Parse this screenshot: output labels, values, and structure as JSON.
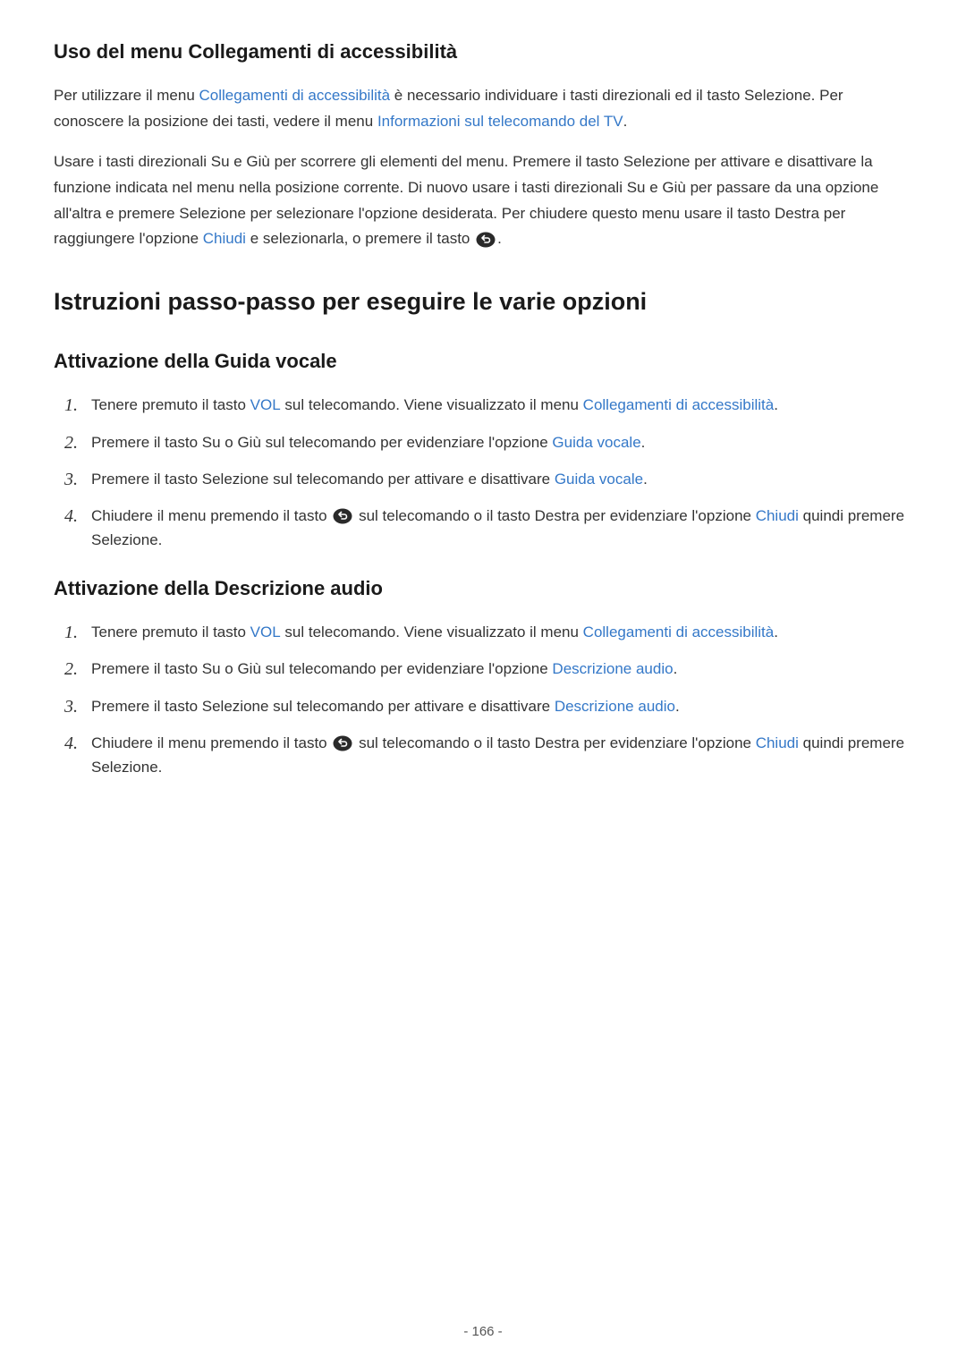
{
  "section1": {
    "title": "Uso del menu Collegamenti di accessibilità",
    "p1a": "Per utilizzare il menu ",
    "p1_link1": "Collegamenti di accessibilità",
    "p1b": " è necessario individuare i tasti direzionali ed il tasto Selezione. Per conoscere la posizione dei tasti, vedere il menu ",
    "p1_link2": "Informazioni sul telecomando del TV",
    "p1c": ".",
    "p2a": "Usare i tasti direzionali Su e Giù per scorrere gli elementi del menu. Premere il tasto Selezione per attivare e disattivare la funzione indicata nel menu nella posizione corrente. Di nuovo usare i tasti direzionali Su e Giù per passare da una opzione all'altra e premere Selezione per selezionare l'opzione desiderata. Per chiudere questo menu usare il tasto Destra per raggiungere l'opzione ",
    "p2_link1": "Chiudi",
    "p2b": " e selezionarla, o premere il tasto ",
    "p2c": "."
  },
  "section2": {
    "title": "Istruzioni passo-passo per eseguire le varie opzioni"
  },
  "section3": {
    "title": "Attivazione della Guida vocale",
    "step1a": "Tenere premuto il tasto ",
    "step1_link1": "VOL",
    "step1b": " sul telecomando. Viene visualizzato il menu ",
    "step1_link2": "Collegamenti di accessibilità",
    "step1c": ".",
    "step2a": "Premere il tasto Su o Giù sul telecomando per evidenziare l'opzione ",
    "step2_link1": "Guida vocale",
    "step2b": ".",
    "step3a": "Premere il tasto Selezione sul telecomando per attivare e disattivare ",
    "step3_link1": "Guida vocale",
    "step3b": ".",
    "step4a": "Chiudere il menu premendo il tasto ",
    "step4b": " sul telecomando o il tasto Destra per evidenziare l'opzione ",
    "step4_link1": "Chiudi",
    "step4c": " quindi premere Selezione."
  },
  "section4": {
    "title": "Attivazione della Descrizione audio",
    "step1a": "Tenere premuto il tasto ",
    "step1_link1": "VOL",
    "step1b": " sul telecomando. Viene visualizzato il menu ",
    "step1_link2": "Collegamenti di accessibilità",
    "step1c": ".",
    "step2a": "Premere il tasto Su o Giù sul telecomando per evidenziare l'opzione ",
    "step2_link1": "Descrizione audio",
    "step2b": ".",
    "step3a": "Premere il tasto Selezione sul telecomando per attivare e disattivare ",
    "step3_link1": "Descrizione audio",
    "step3b": ".",
    "step4a": "Chiudere il menu premendo il tasto ",
    "step4b": " sul telecomando o il tasto Destra per evidenziare l'opzione ",
    "step4_link1": "Chiudi",
    "step4c": " quindi premere Selezione."
  },
  "numbers": {
    "n1": "1.",
    "n2": "2.",
    "n3": "3.",
    "n4": "4."
  },
  "pageNum": "- 166 -"
}
